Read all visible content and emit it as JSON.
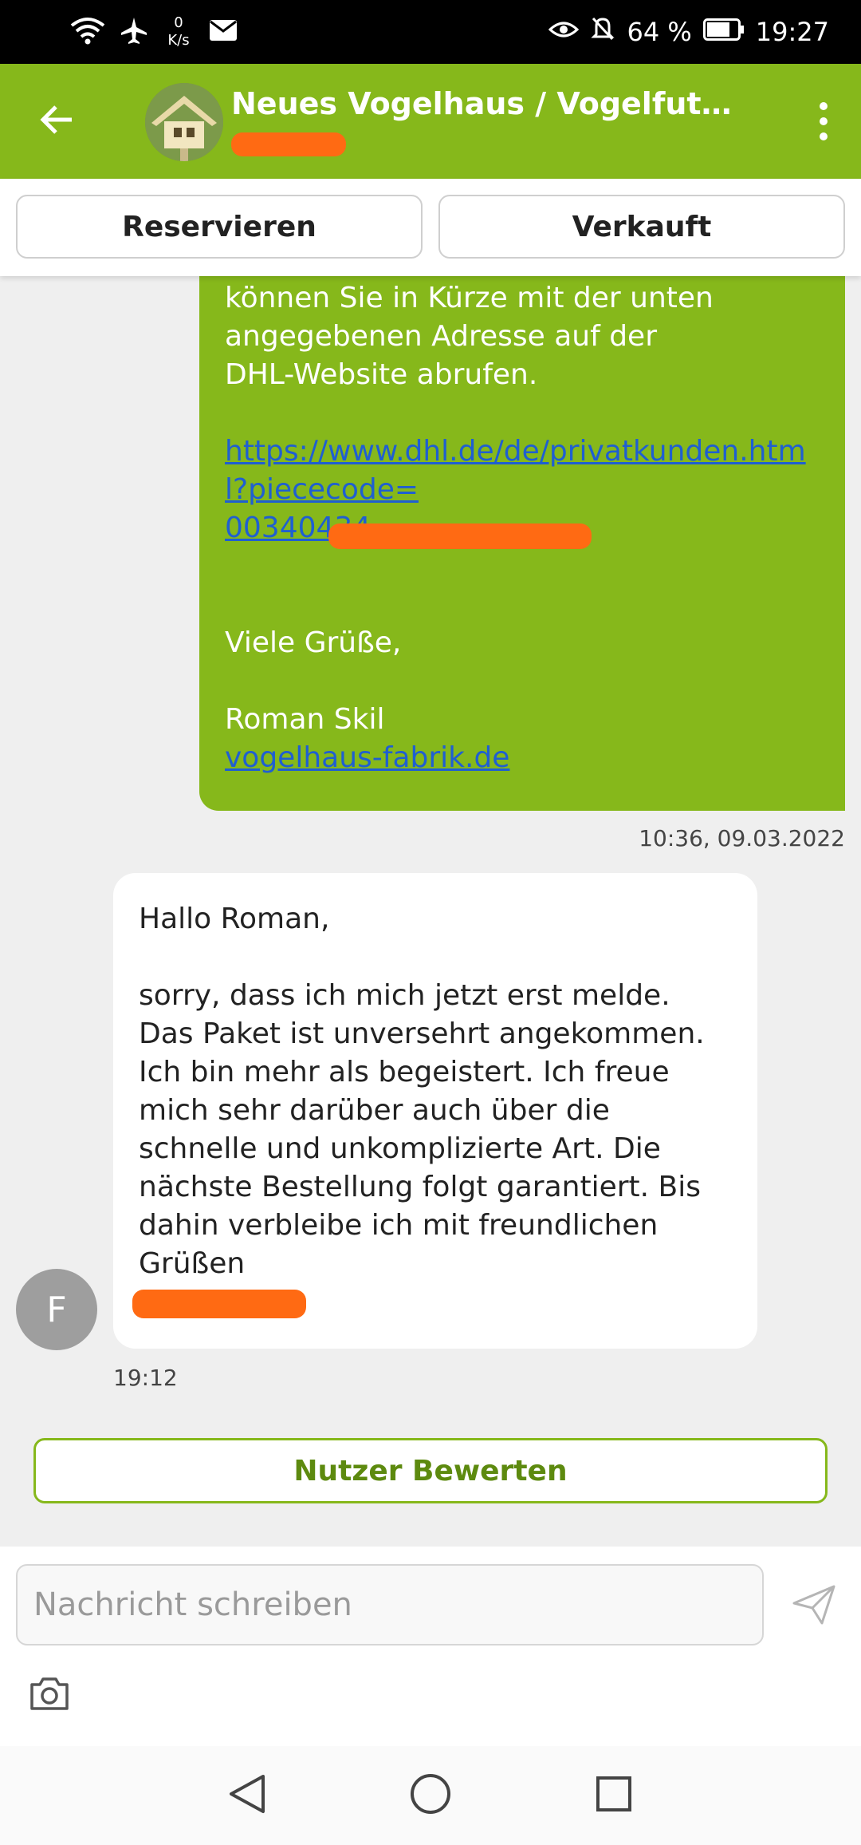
{
  "status_bar": {
    "net_speed_value": "0",
    "net_speed_unit": "K/s",
    "battery": "64 %",
    "time": "19:27"
  },
  "header": {
    "title": "Neues Vogelhaus / Vogelfutterha…"
  },
  "actions": {
    "reserve_label": "Reservieren",
    "sold_label": "Verkauft"
  },
  "outgoing_message": {
    "text_top": "können Sie in Kürze mit der unten\nangegebenen Adresse auf der\nDHL-Website abrufen.",
    "link": "https://www.dhl.de/de/privatkunden.html?piececode=\n00340434…",
    "closing": "Viele Grüße,",
    "signature_name": "Roman Skil",
    "signature_link": "vogelhaus-fabrik.de",
    "time": "10:36, 09.03.2022"
  },
  "incoming_message": {
    "greeting": "Hallo Roman,",
    "body": "sorry, dass ich mich jetzt erst melde. Das Paket ist unversehrt angekommen. Ich bin mehr als begeistert. Ich freue mich sehr darüber auch über die schnelle und unkomplizierte Art. Die nächste Bestellung folgt garantiert. Bis dahin verbleibe ich mit freundlichen Grüßen",
    "sender_initial": "F",
    "time": "19:12"
  },
  "rate_button_label": "Nutzer Bewerten",
  "composer": {
    "placeholder": "Nachricht schreiben"
  },
  "colors": {
    "brand_green": "#86b81b",
    "redaction_orange": "#ff6a13"
  },
  "icons": [
    "wifi-icon",
    "airplane-icon",
    "mail-icon",
    "eye-icon",
    "bell-off-icon",
    "battery-icon",
    "back-arrow-icon",
    "more-vert-icon",
    "send-icon",
    "camera-icon",
    "nav-back-icon",
    "nav-home-icon",
    "nav-recents-icon"
  ]
}
